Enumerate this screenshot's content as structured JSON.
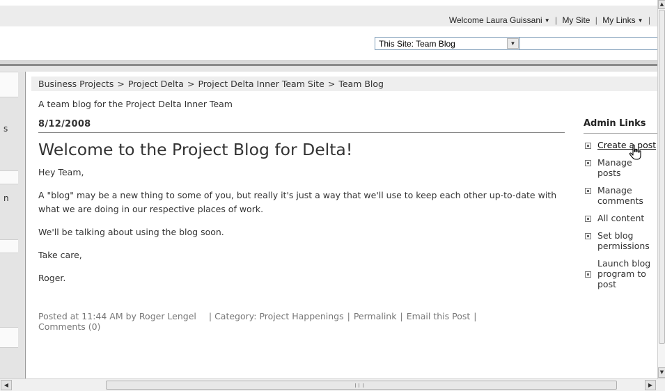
{
  "topbar": {
    "welcome_label": "Welcome Laura Guissani",
    "my_site_label": "My Site",
    "my_links_label": "My Links",
    "separator": "|"
  },
  "search": {
    "scope_value": "This Site: Team Blog",
    "query_value": ""
  },
  "breadcrumb": {
    "items": [
      "Business Projects",
      "Project Delta",
      "Project Delta Inner Team Site",
      "Team Blog"
    ],
    "separator": ">"
  },
  "site": {
    "description": "A team blog for the Project Delta Inner Team"
  },
  "post": {
    "date": "8/12/2008",
    "title": "Welcome to the Project Blog for Delta!",
    "paragraphs": [
      "Hey Team,",
      "A \"blog\" may be a new  thing to some of you, but really it's just a way that we'll use to keep each other up-to-date with what we are doing in our respective places of work.",
      "We'll be talking about using the blog soon.",
      "Take care,",
      "Roger."
    ],
    "footer": {
      "posted_prefix": "Posted at 11:44 AM by",
      "author": "Roger Lengel",
      "category_prefix": "Category:",
      "category": "Project Happenings",
      "permalink_label": "Permalink",
      "email_label": "Email this Post",
      "comments_label": "Comments (0)",
      "separator": "|"
    }
  },
  "admin": {
    "heading": "Admin Links",
    "items": [
      {
        "label": "Create a post"
      },
      {
        "label": "Manage posts"
      },
      {
        "label": "Manage comments"
      },
      {
        "label": "All content"
      },
      {
        "label": "Set blog permissions"
      },
      {
        "label": "Launch blog program to post"
      }
    ]
  },
  "leftnav": {
    "fragments": [
      "s",
      "n"
    ]
  },
  "icons": {
    "dropdown": "chevron-down-icon",
    "bullet": "square-bullet-icon",
    "cursor": "hand-pointer-icon"
  }
}
